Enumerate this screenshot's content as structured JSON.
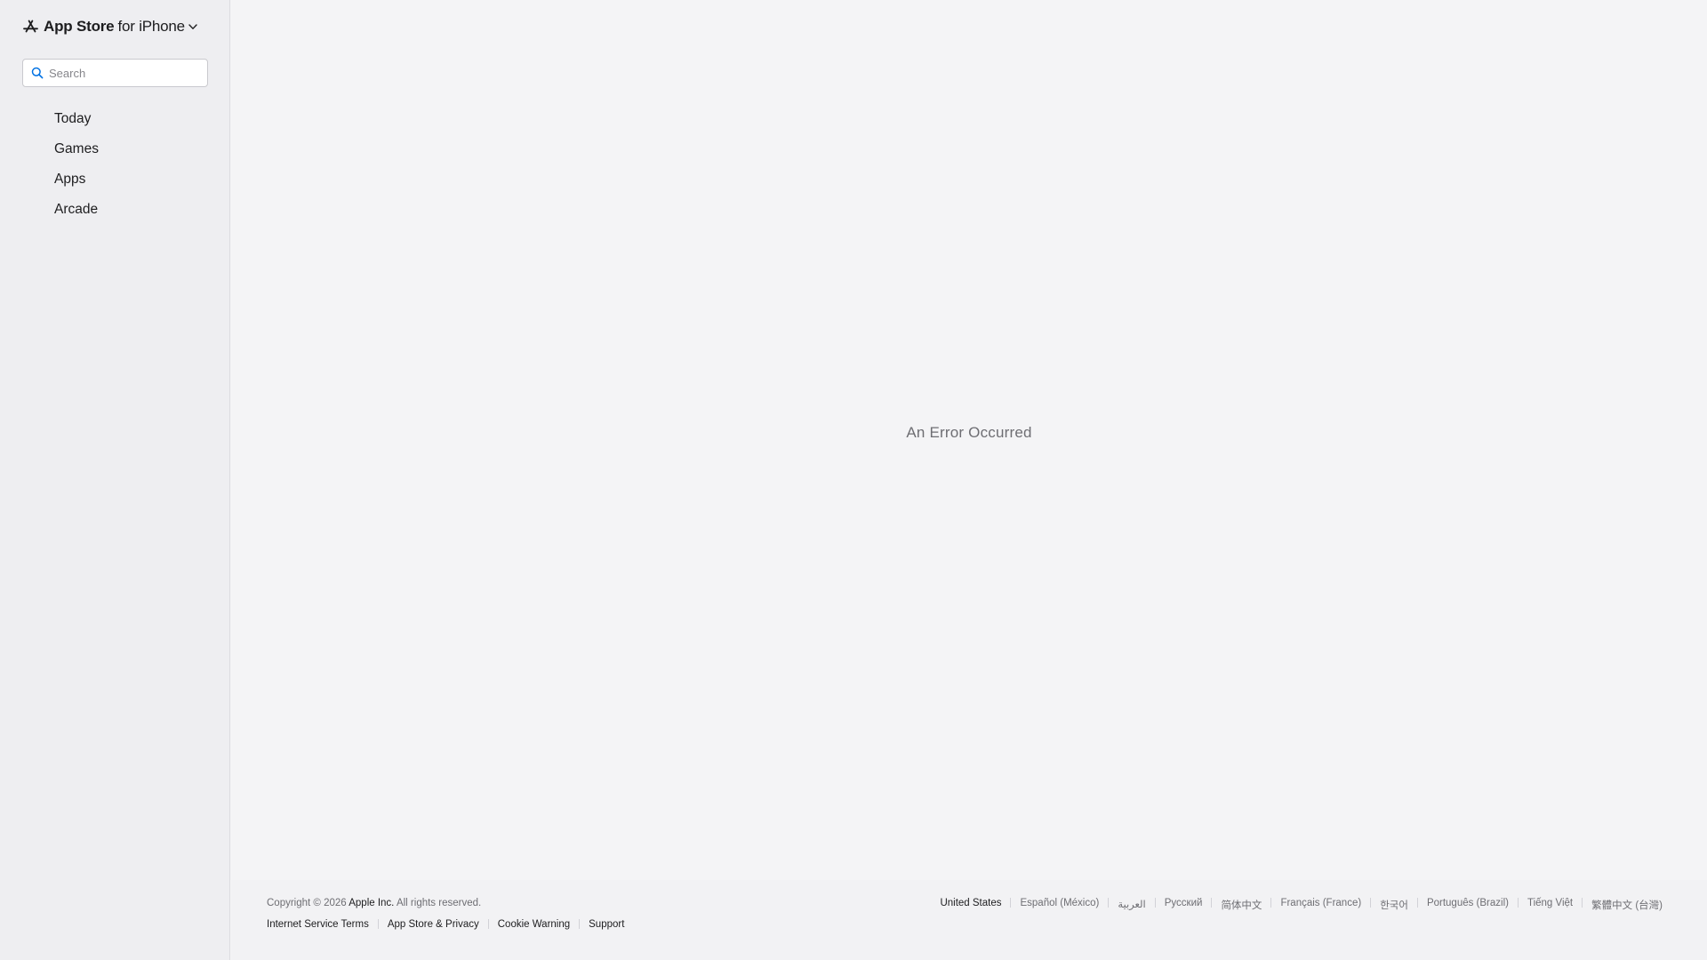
{
  "sidebar": {
    "brand_name": "App Store",
    "brand_sub": "for iPhone",
    "search_placeholder": "Search",
    "nav": [
      "Today",
      "Games",
      "Apps",
      "Arcade"
    ]
  },
  "main": {
    "error_message": "An Error Occurred"
  },
  "footer": {
    "copyright_prefix": "Copyright © 2026",
    "company": "Apple Inc.",
    "rights": "All rights reserved.",
    "legal_links": [
      "Internet Service Terms",
      "App Store & Privacy",
      "Cookie Warning",
      "Support"
    ],
    "languages": [
      "United States",
      "Español (México)",
      "العربية",
      "Русский",
      "简体中文",
      "Français (France)",
      "한국어",
      "Português (Brazil)",
      "Tiếng Việt",
      "繁體中文 (台灣)"
    ]
  },
  "icons": {
    "brand": "app-store-icon",
    "chevron": "chevron-down-icon",
    "search": "search-icon"
  },
  "colors": {
    "search_icon": "#0071e3",
    "text_primary": "#1d1d1f",
    "text_secondary": "#6e6e73"
  }
}
